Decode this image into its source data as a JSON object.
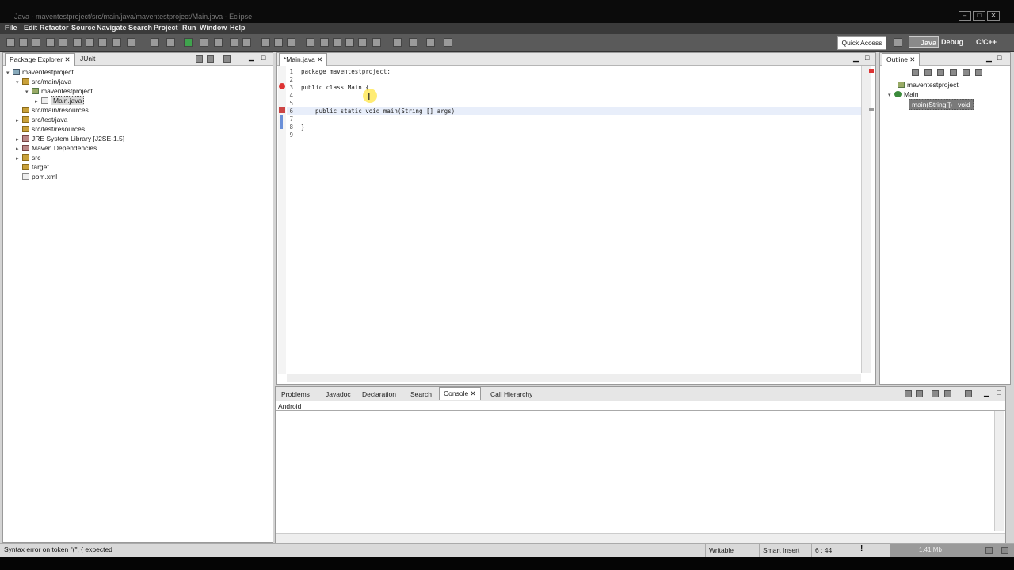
{
  "window": {
    "title": "Java - maventestproject/src/main/java/maventestproject/Main.java - Eclipse",
    "controls": [
      "–",
      "□",
      "✕"
    ]
  },
  "menu": [
    "File",
    "Edit",
    "Refactor",
    "Source",
    "Navigate",
    "Search",
    "Project",
    "Run",
    "Window",
    "Help"
  ],
  "toolbar": {
    "quick_access": "Quick Access",
    "perspectives": [
      "Java",
      "Debug",
      "C/C++"
    ]
  },
  "package_explorer": {
    "tabs": [
      "Package Explorer",
      "JUnit"
    ],
    "tree": [
      {
        "label": "maventestproject",
        "level": 0,
        "twisty": "▾",
        "icon": "proj"
      },
      {
        "label": "src/main/java",
        "level": 1,
        "twisty": "▾",
        "icon": "fold"
      },
      {
        "label": "maventestproject",
        "level": 2,
        "twisty": "▾",
        "icon": "pkg"
      },
      {
        "label": "Main.java",
        "level": 3,
        "twisty": "▸",
        "icon": "file",
        "selected": true
      },
      {
        "label": "src/main/resources",
        "level": 1,
        "twisty": "",
        "icon": "fold"
      },
      {
        "label": "src/test/java",
        "level": 1,
        "twisty": "▸",
        "icon": "fold"
      },
      {
        "label": "src/test/resources",
        "level": 1,
        "twisty": "",
        "icon": "fold"
      },
      {
        "label": "JRE System Library [J2SE-1.5]",
        "level": 1,
        "twisty": "▸",
        "icon": "jar"
      },
      {
        "label": "Maven Dependencies",
        "level": 1,
        "twisty": "▸",
        "icon": "jar"
      },
      {
        "label": "src",
        "level": 1,
        "twisty": "▸",
        "icon": "fold"
      },
      {
        "label": "target",
        "level": 1,
        "twisty": "",
        "icon": "fold"
      },
      {
        "label": "pom.xml",
        "level": 1,
        "twisty": "",
        "icon": "file"
      }
    ]
  },
  "editor": {
    "tab": "*Main.java",
    "lines": [
      {
        "n": "1",
        "text": "package maventestproject;"
      },
      {
        "n": "2",
        "text": ""
      },
      {
        "n": "3",
        "text": "public class Main {"
      },
      {
        "n": "4",
        "text": ""
      },
      {
        "n": "5",
        "text": ""
      },
      {
        "n": "6",
        "text": "    public static void main(String [] args)"
      },
      {
        "n": "7",
        "text": ""
      },
      {
        "n": "8",
        "text": "}"
      },
      {
        "n": "9",
        "text": ""
      }
    ]
  },
  "outline": {
    "tab": "Outline",
    "items": [
      "maventestproject",
      "Main",
      "main(String[]) : void"
    ]
  },
  "bottom_panel": {
    "tabs": [
      "Problems",
      "Javadoc",
      "Declaration",
      "Search",
      "Console",
      "Call Hierarchy"
    ],
    "active_tab": "Console",
    "console_title": "Android"
  },
  "status": {
    "message": "Syntax error on token \"(\", { expected",
    "writable": "Writable",
    "insert_mode": "Smart Insert",
    "position": "6 : 44",
    "memory": "1.41 Mb"
  }
}
